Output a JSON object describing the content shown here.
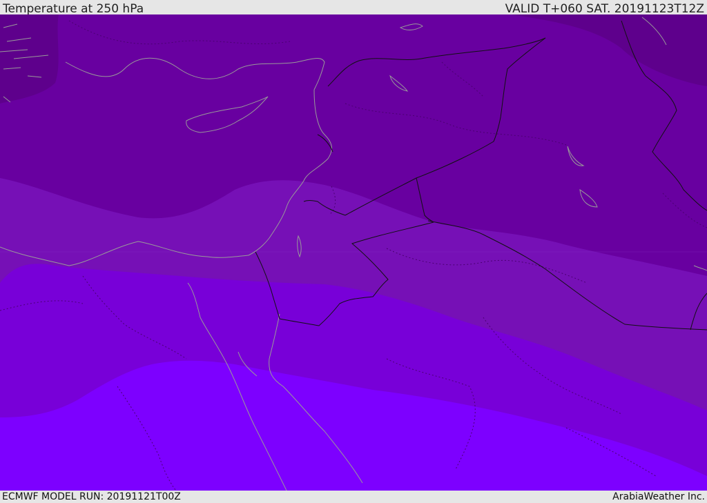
{
  "header": {
    "title": "Temperature at 250 hPa",
    "valid": "VALID T+060 SAT. 20191123T12Z"
  },
  "footer": {
    "model_run": "ECMWF MODEL RUN: 20191121T00Z",
    "credit": "ArabiaWeather Inc."
  },
  "colors": {
    "band_darkest": "#5e008c",
    "band_dark": "#6800a0",
    "band_mid": "#7610b6",
    "band_bright": "#7800d8",
    "band_brightest": "#7d00ff",
    "borders": "#111111",
    "coastline": "#9a9a9a"
  }
}
